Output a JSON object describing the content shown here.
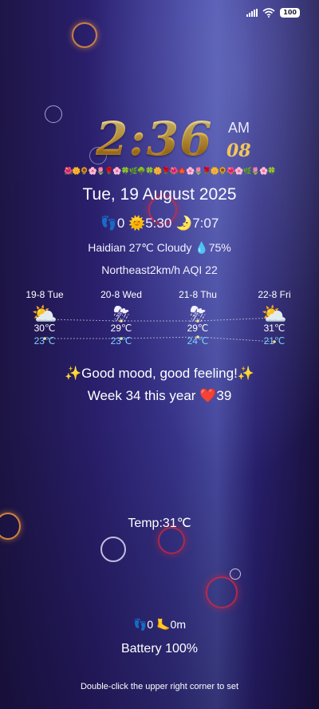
{
  "status_bar": {
    "battery": "100"
  },
  "clock": {
    "time": "2:36",
    "ampm": "AM",
    "seconds": "08"
  },
  "flower_strip": "🌺🌼🌻🌸🌷🌹🌸🍀🌿🌳🍀🌼🌹🌺🍁🌸🌷🌹🌼🌻🌺🌸🌿🌷🌸🍀",
  "date": "Tue, 19 August 2025",
  "sun_row": {
    "steps_icon": "👣",
    "steps": "0",
    "sunrise_icon": "🌞",
    "sunrise": "5:30",
    "moon_icon": "🌛",
    "sunset": "7:07"
  },
  "weather_row": {
    "city": "Haidian",
    "temp": "27℃",
    "condition": "Cloudy",
    "humidity_icon": "💧",
    "humidity": "75%"
  },
  "wind_row": {
    "wind": "Northeast",
    "speed": "2km/h",
    "aqi": "AQI 22"
  },
  "forecast": [
    {
      "day": "19-8 Tue",
      "icon": "partly-cloudy-icon",
      "glyph": "⛅",
      "high": "30℃",
      "low": "23℃",
      "high_value": 30,
      "low_value": 23
    },
    {
      "day": "20-8 Wed",
      "icon": "thunderstorm-icon",
      "glyph": "⛈",
      "high": "29℃",
      "low": "23℃",
      "high_value": 29,
      "low_value": 23
    },
    {
      "day": "21-8 Thu",
      "icon": "thunderstorm-icon",
      "glyph": "⛈",
      "high": "29℃",
      "low": "24℃",
      "high_value": 29,
      "low_value": 24
    },
    {
      "day": "22-8 Fri",
      "icon": "partly-cloudy-icon",
      "glyph": "⛅",
      "high": "31℃",
      "low": "21℃",
      "high_value": 31,
      "low_value": 21
    }
  ],
  "mood": "✨Good mood, good feeling!✨",
  "week_row": {
    "text": "Week 34 this year",
    "heart": "❤️",
    "days": "39"
  },
  "temp_label": "Temp:31℃",
  "steps_row": {
    "steps_icon": "👣",
    "steps": "0",
    "distance_icon": "🦶",
    "distance": "0m"
  },
  "battery_text": "Battery 100%",
  "hint": "Double-click the upper right corner to set",
  "colors": {
    "background_start": "#1e1547",
    "background_mid": "#3a3690",
    "clock_gold": "#f3c65a",
    "low_temp": "#7fd4ff"
  }
}
